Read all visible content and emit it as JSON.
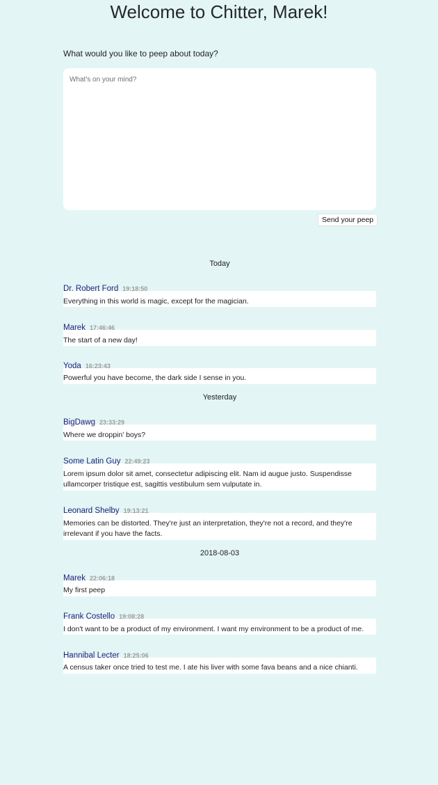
{
  "header": {
    "title": "Welcome to Chitter, Marek!"
  },
  "composer": {
    "prompt": "What would you like to peep about today?",
    "placeholder": "What's on your mind?",
    "value": "",
    "send_label": "Send your peep"
  },
  "feed": {
    "groups": [
      {
        "day": "Today",
        "peeps": [
          {
            "author": "Dr. Robert Ford",
            "time": "19:18:50",
            "text": "Everything in this world is magic, except for the magician."
          },
          {
            "author": "Marek",
            "time": "17:46:46",
            "text": "The start of a new day!"
          },
          {
            "author": "Yoda",
            "time": "16:23:43",
            "text": "Powerful you have become, the dark side I sense in you."
          }
        ]
      },
      {
        "day": "Yesterday",
        "peeps": [
          {
            "author": "BigDawg",
            "time": "23:33:29",
            "text": "Where we droppin' boys?"
          },
          {
            "author": "Some Latin Guy",
            "time": "22:49:23",
            "text": "Lorem ipsum dolor sit amet, consectetur adipiscing elit. Nam id augue justo. Suspendisse ullamcorper tristique est, sagittis vestibulum sem vulputate in."
          },
          {
            "author": "Leonard Shelby",
            "time": "19:13:21",
            "text": "Memories can be distorted. They're just an interpretation, they're not a record, and they're irrelevant if you have the facts."
          }
        ]
      },
      {
        "day": "2018-08-03",
        "peeps": [
          {
            "author": "Marek",
            "time": "22:06:18",
            "text": "My first peep"
          },
          {
            "author": "Frank Costello",
            "time": "19:08:28",
            "text": "I don't want to be a product of my environment. I want my environment to be a product of me."
          },
          {
            "author": "Hannibal Lecter",
            "time": "18:25:06",
            "text": "A census taker once tried to test me. I ate his liver with some fava beans and a nice chianti."
          }
        ]
      }
    ]
  }
}
